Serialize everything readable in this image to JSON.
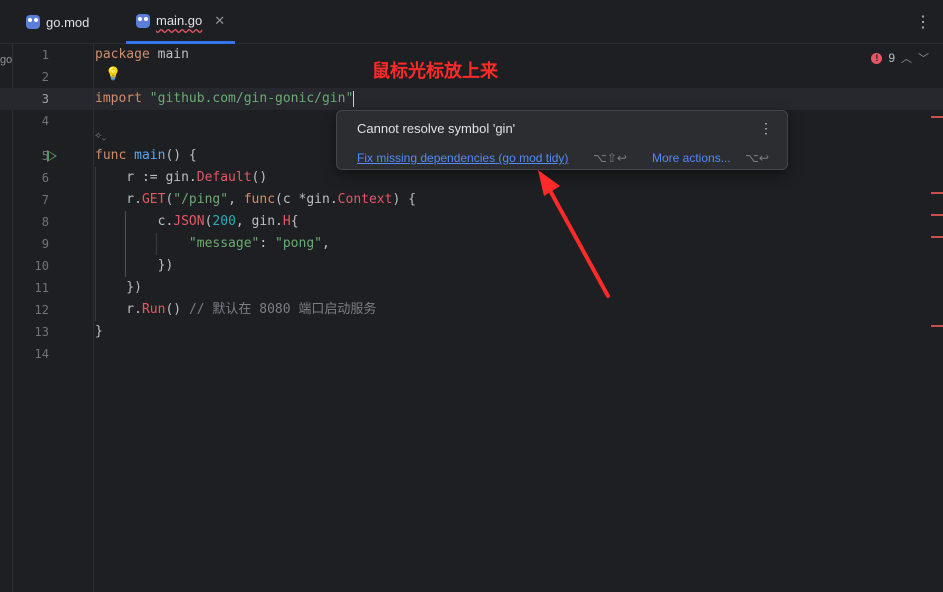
{
  "tabs": [
    {
      "label": "go.mod",
      "active": false
    },
    {
      "label": "main.go",
      "active": true
    }
  ],
  "project_label": "go",
  "errors": {
    "count": "9"
  },
  "line_numbers": [
    "1",
    "2",
    "3",
    "4",
    "5",
    "6",
    "7",
    "8",
    "9",
    "10",
    "11",
    "12",
    "13",
    "14"
  ],
  "code": {
    "l1_kw": "package",
    "l1_name": " main",
    "l3_kw": "import",
    "l3_str": " \"github.com/gin-gonic/gin\"",
    "l5_kw": "func",
    "l5_fn": " main",
    "l5_rest": "() {",
    "l6_a": "    r := gin.",
    "l6_b": "Default",
    "l6_c": "()",
    "l7_a": "    r.",
    "l7_b": "GET",
    "l7_c": "(",
    "l7_str": "\"/ping\"",
    "l7_d": ", ",
    "l7_kw": "func",
    "l7_e": "(c *gin.",
    "l7_f": "Context",
    "l7_g": ") {",
    "l8_a": "        c.",
    "l8_b": "JSON",
    "l8_c": "(",
    "l8_num": "200",
    "l8_d": ", gin.",
    "l8_e": "H",
    "l8_f": "{",
    "l9_a": "            ",
    "l9_str1": "\"message\"",
    "l9_b": ": ",
    "l9_str2": "\"pong\"",
    "l9_c": ",",
    "l10": "        })",
    "l11": "    })",
    "l12_a": "    r.",
    "l12_b": "Run",
    "l12_c": "() ",
    "l12_cmt": "// 默认在 8080 端口启动服务",
    "l13": "}"
  },
  "popup": {
    "message": "Cannot resolve symbol 'gin'",
    "fix_label": "Fix missing dependencies (go mod tidy)",
    "fix_shortcut": "⌥⇧↩",
    "more_actions_label": "More actions...",
    "more_shortcut": "⌥↩"
  },
  "annotation": {
    "text": "鼠标光标放上来",
    "color": "#ff2a2a"
  },
  "colors": {
    "accent": "#3574f0",
    "error": "#e55765",
    "keyword": "#cf8e6d",
    "string": "#6aab73",
    "function": "#56a8f5"
  }
}
